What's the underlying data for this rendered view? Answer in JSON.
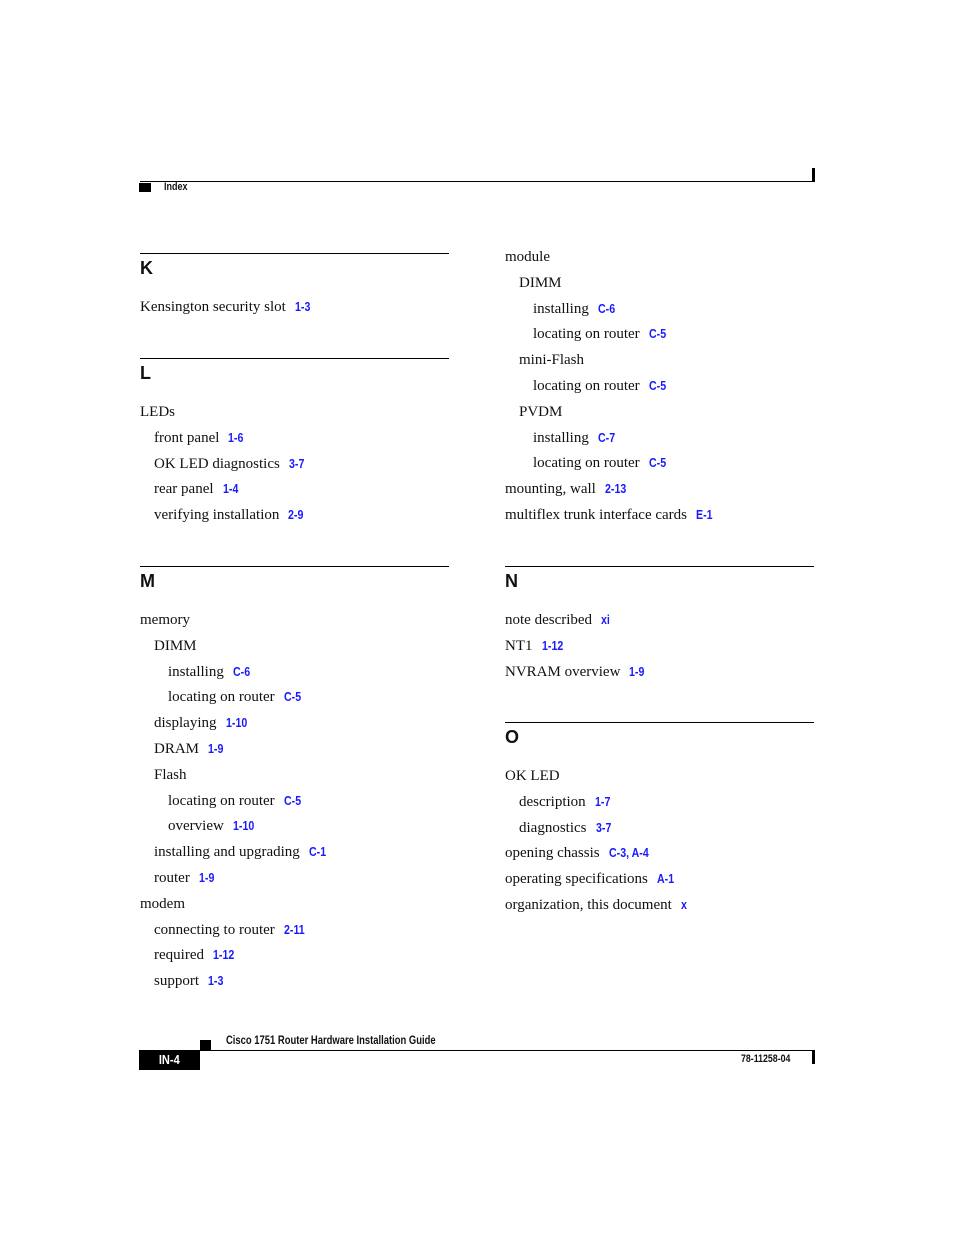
{
  "header": {
    "section_label": "Index"
  },
  "footer": {
    "guide_title": "Cisco 1751 Router Hardware Installation Guide",
    "page_number": "IN-4",
    "doc_number": "78-11258-04"
  },
  "index": {
    "K": {
      "letter": "K",
      "entries": [
        {
          "text": "Kensington security slot",
          "ref": "1-3",
          "level": 0
        }
      ]
    },
    "L": {
      "letter": "L",
      "entries": [
        {
          "text": "LEDs",
          "ref": "",
          "level": 0
        },
        {
          "text": "front panel",
          "ref": "1-6",
          "level": 1
        },
        {
          "text": "OK LED diagnostics",
          "ref": "3-7",
          "level": 1
        },
        {
          "text": "rear panel",
          "ref": "1-4",
          "level": 1
        },
        {
          "text": "verifying installation",
          "ref": "2-9",
          "level": 1
        }
      ]
    },
    "M": {
      "letter": "M",
      "entries": [
        {
          "text": "memory",
          "ref": "",
          "level": 0
        },
        {
          "text": "DIMM",
          "ref": "",
          "level": 1
        },
        {
          "text": "installing",
          "ref": "C-6",
          "level": 2
        },
        {
          "text": "locating on router",
          "ref": "C-5",
          "level": 2
        },
        {
          "text": "displaying",
          "ref": "1-10",
          "level": 1
        },
        {
          "text": "DRAM",
          "ref": "1-9",
          "level": 1
        },
        {
          "text": "Flash",
          "ref": "",
          "level": 1
        },
        {
          "text": "locating on router",
          "ref": "C-5",
          "level": 2
        },
        {
          "text": "overview",
          "ref": "1-10",
          "level": 2
        },
        {
          "text": "installing and upgrading",
          "ref": "C-1",
          "level": 1
        },
        {
          "text": "router",
          "ref": "1-9",
          "level": 1
        },
        {
          "text": "modem",
          "ref": "",
          "level": 0
        },
        {
          "text": "connecting to router",
          "ref": "2-11",
          "level": 1
        },
        {
          "text": "required",
          "ref": "1-12",
          "level": 1
        },
        {
          "text": "support",
          "ref": "1-3",
          "level": 1
        }
      ]
    },
    "M_cont": {
      "entries": [
        {
          "text": "module",
          "ref": "",
          "level": 0
        },
        {
          "text": "DIMM",
          "ref": "",
          "level": 1
        },
        {
          "text": "installing",
          "ref": "C-6",
          "level": 2
        },
        {
          "text": "locating on router",
          "ref": "C-5",
          "level": 2
        },
        {
          "text": "mini-Flash",
          "ref": "",
          "level": 1
        },
        {
          "text": "locating on router",
          "ref": "C-5",
          "level": 2
        },
        {
          "text": "PVDM",
          "ref": "",
          "level": 1
        },
        {
          "text": "installing",
          "ref": "C-7",
          "level": 2
        },
        {
          "text": "locating on router",
          "ref": "C-5",
          "level": 2
        },
        {
          "text": "mounting, wall",
          "ref": "2-13",
          "level": 0
        },
        {
          "text": "multiflex trunk interface cards",
          "ref": "E-1",
          "level": 0
        }
      ]
    },
    "N": {
      "letter": "N",
      "entries": [
        {
          "text": "note described",
          "ref": "xi",
          "level": 0
        },
        {
          "text": "NT1",
          "ref": "1-12",
          "level": 0
        },
        {
          "text": "NVRAM overview",
          "ref": "1-9",
          "level": 0
        }
      ]
    },
    "O": {
      "letter": "O",
      "entries": [
        {
          "text": "OK LED",
          "ref": "",
          "level": 0
        },
        {
          "text": "description",
          "ref": "1-7",
          "level": 1
        },
        {
          "text": "diagnostics",
          "ref": "3-7",
          "level": 1
        },
        {
          "text": "opening chassis",
          "ref": "C-3, A-4",
          "level": 0
        },
        {
          "text": "operating specifications",
          "ref": "A-1",
          "level": 0
        },
        {
          "text": "organization, this document",
          "ref": "x",
          "level": 0
        }
      ]
    }
  },
  "colors": {
    "link": "#1a1aff",
    "text": "#111111",
    "rule": "#000000"
  }
}
